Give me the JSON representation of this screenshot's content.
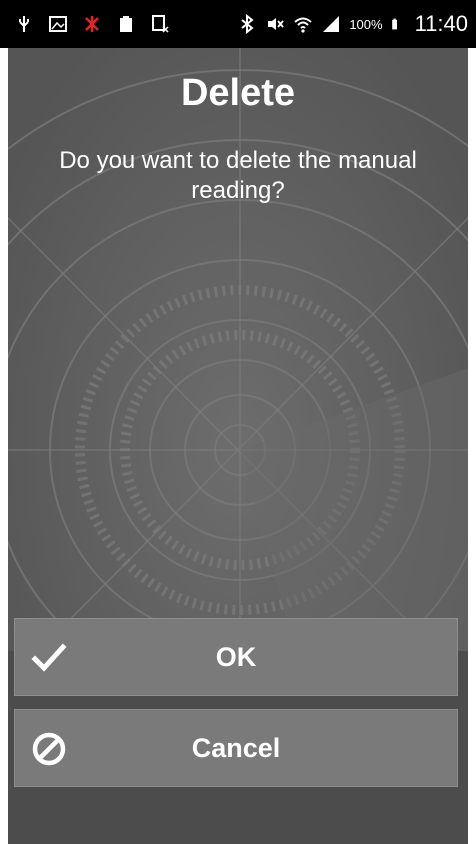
{
  "status_bar": {
    "icons": [
      "usb-icon",
      "image-icon",
      "no-signal-icon",
      "battery-small-icon",
      "clipboard-icon",
      "bluetooth-icon",
      "mute-icon",
      "wifi-icon",
      "signal-icon"
    ],
    "battery": "100%",
    "time": "11:40"
  },
  "dialog": {
    "title": "Delete",
    "message": "Do you want to delete the manual reading?"
  },
  "buttons": {
    "ok_label": "OK",
    "cancel_label": "Cancel"
  },
  "colors": {
    "status_bar_bg": "#000000",
    "screen_bg": "#5f5f5f",
    "button_bg": "#7a7a7a",
    "text": "#ffffff"
  }
}
